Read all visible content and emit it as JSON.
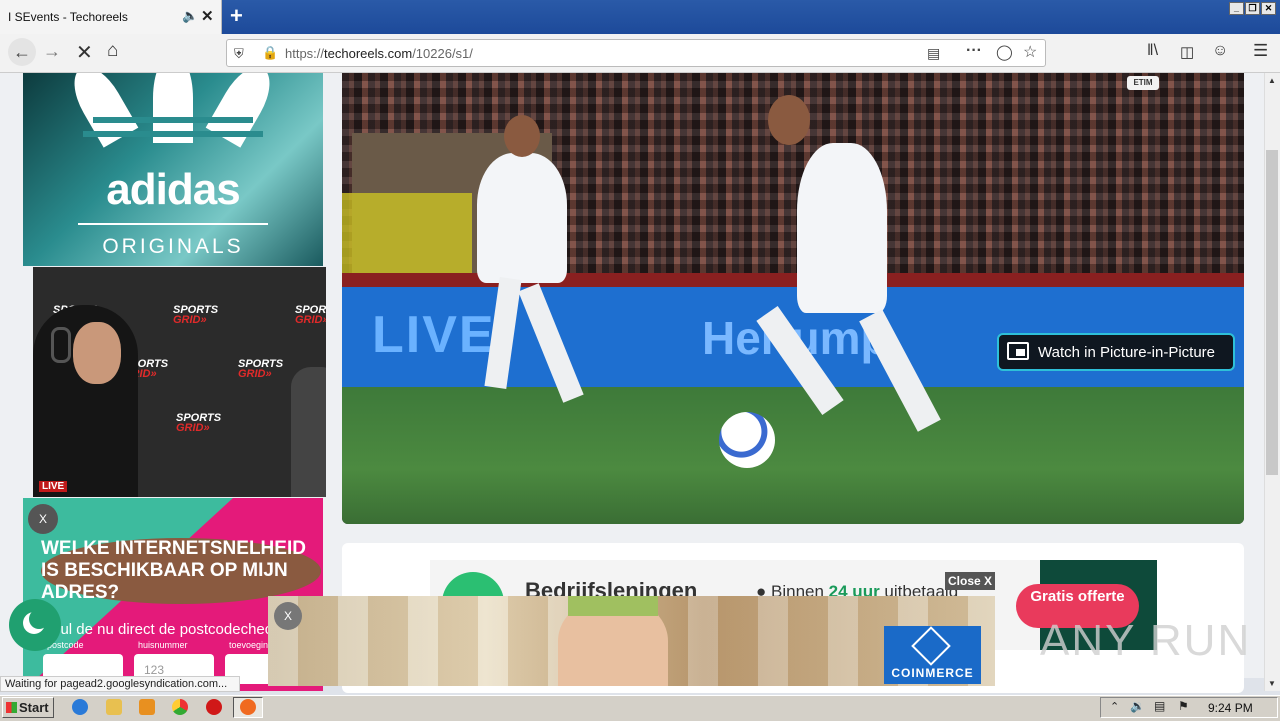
{
  "browser": {
    "tab_title": "I SEvents - Techoreels",
    "tab_audio_icon": "speaker-icon",
    "url_prefix": "https://",
    "url_domain": "techoreels.com",
    "url_path": "/10226/s1/",
    "status_text": "Waiting for pagead2.googlesyndication.com..."
  },
  "ads": {
    "adidas_brand": "adidas",
    "adidas_sub": "ORIGINALS",
    "sportsgrid_logo_top": "SPORTS",
    "sportsgrid_logo_bottom": "GRID»",
    "sportsgrid_live": "LIVE",
    "pink_headline": "WELKE INTERNETSNELHEID IS BESCHIKBAAR OP MIJN ADRES?",
    "pink_body": "Vul de nu direct de postcodecheck",
    "pink_labels": [
      "postcode",
      "huisnummer",
      "toevoeging"
    ],
    "pink_placeholder": "123",
    "pink_close": "X",
    "loan_title": "Bedrijfsleningen",
    "loan_bullet_pre": "Binnen ",
    "loan_bullet_bold": "24 uur",
    "loan_bullet_post": " uitbetaald",
    "loan_cta": "Gratis offerte",
    "close_ad": "Close X",
    "coin_brand": "COINMERCE",
    "coin_close": "X"
  },
  "video": {
    "pip_label": "Watch in Picture-in-Picture",
    "led_left": "LIVE",
    "led_right": "Her  ump",
    "broadcaster_badge": "ETIM"
  },
  "watermark": "ANY RUN",
  "taskbar": {
    "start_label": "Start",
    "clock": "9:24 PM"
  },
  "colors": {
    "titlebar": "#2a5aa8",
    "pip_border": "#2ec0d8",
    "moon_button": "#20a070",
    "loan_cta": "#e93a5c",
    "coin_blue": "#1a6ac8"
  }
}
